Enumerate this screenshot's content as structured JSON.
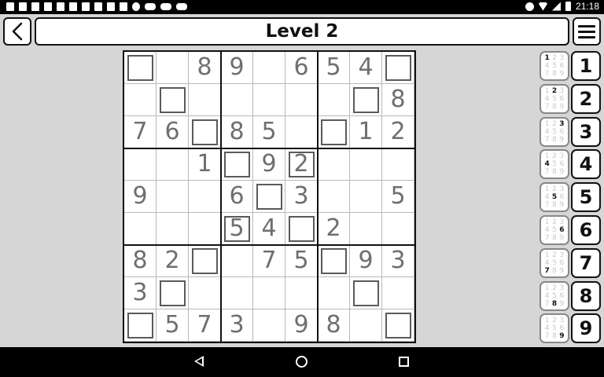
{
  "status_bar": {
    "time": "21:18",
    "notification_icons": [
      "facebook-icon",
      "facebook-icon",
      "facebook-icon",
      "facebook-icon",
      "facebook-icon",
      "facebook-icon",
      "photo-icon",
      "mail-icon",
      "message-icon",
      "play-store-icon",
      "cat-icon",
      "youtube-icon",
      "youtube-icon",
      "youtube-icon"
    ],
    "system_icons": [
      "do-not-disturb-icon",
      "wifi-icon",
      "signal-icon",
      "battery-icon"
    ]
  },
  "header": {
    "title": "Level 2",
    "back_icon": "chevron-left-icon",
    "menu_icon": "hamburger-menu-icon"
  },
  "board": {
    "rows": [
      [
        "#",
        "",
        "8",
        "9",
        "",
        "6",
        "5",
        "4",
        "#"
      ],
      [
        "",
        "#",
        "",
        "",
        "",
        "",
        "",
        "#",
        "8"
      ],
      [
        "7",
        "6",
        "#",
        "8",
        "5",
        "",
        "#",
        "1",
        "2"
      ],
      [
        "",
        "",
        "1",
        "#",
        "9",
        "2",
        "",
        "",
        ""
      ],
      [
        "9",
        "",
        "",
        "6",
        "#",
        "3",
        "",
        "",
        "5"
      ],
      [
        "",
        "",
        "",
        "5",
        "4",
        "#",
        "2",
        "",
        ""
      ],
      [
        "8",
        "2",
        "#",
        "",
        "7",
        "5",
        "#",
        "9",
        "3"
      ],
      [
        "3",
        "#",
        "",
        "",
        "",
        "",
        "",
        "#",
        ""
      ],
      [
        "#",
        "5",
        "7",
        "3",
        "",
        "9",
        "8",
        "",
        "#"
      ]
    ],
    "boxed_given_cells": [
      [
        3,
        5
      ],
      [
        5,
        3
      ]
    ]
  },
  "number_pad": {
    "hint_digits": [
      "1",
      "2",
      "3",
      "4",
      "5",
      "6",
      "7",
      "8",
      "9"
    ],
    "buttons": [
      "1",
      "2",
      "3",
      "4",
      "5",
      "6",
      "7",
      "8",
      "9"
    ]
  },
  "nav_bar": {
    "icons": [
      "back-triangle-icon",
      "home-circle-icon",
      "recents-square-icon"
    ]
  }
}
